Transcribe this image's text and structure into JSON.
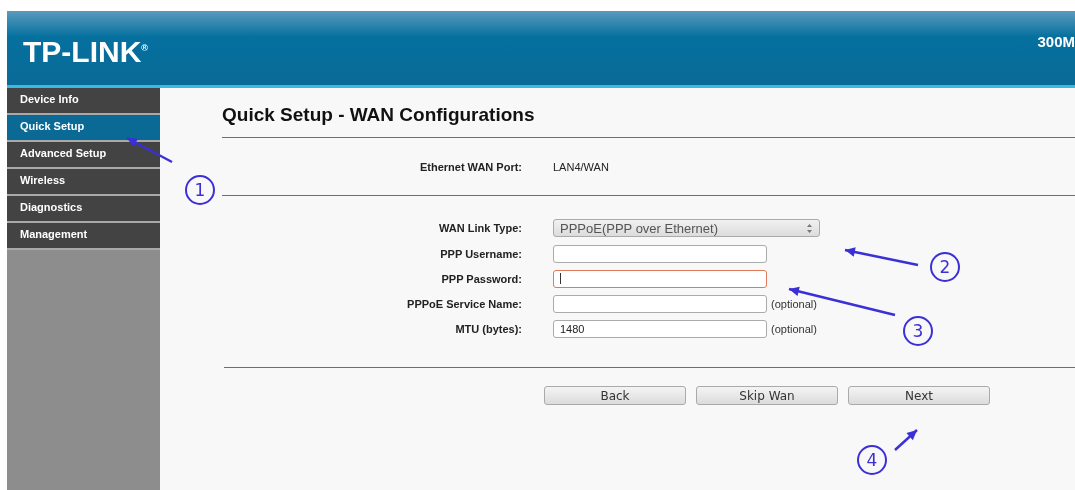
{
  "header": {
    "logo": "TP-LINK$^{®}$",
    "model": "300M"
  },
  "sidebar": {
    "items": [
      {
        "label": "Device Info",
        "selected": false
      },
      {
        "label": "Quick Setup",
        "selected": true
      },
      {
        "label": "Advanced Setup",
        "selected": false
      },
      {
        "label": "Wireless",
        "selected": false
      },
      {
        "label": "Diagnostics",
        "selected": false
      },
      {
        "label": "Management",
        "selected": false
      }
    ]
  },
  "page": {
    "title": "Quick Setup - WAN Configurations",
    "port": {
      "label": "Ethernet WAN Port:",
      "value": "LAN4/WAN"
    },
    "fields": [
      {
        "kind": "select",
        "label": "WAN Link Type:",
        "value": "PPPoE(PPP over Ethernet)",
        "focused": false
      },
      {
        "kind": "input",
        "label": "PPP Username:",
        "focused": false
      },
      {
        "kind": "input",
        "label": "PPP Password:",
        "focused": true
      },
      {
        "kind": "input",
        "label": "PPPoE Service Name:",
        "focused": false,
        "note": "(optional)"
      },
      {
        "kind": "input",
        "label": "MTU (bytes):",
        "value": "1480",
        "focused": false,
        "note": "(optional)"
      }
    ],
    "buttons": [
      "Back",
      "Skip Wan",
      "Next"
    ]
  },
  "annotations": [
    "1",
    "2",
    "3",
    "4"
  ]
}
